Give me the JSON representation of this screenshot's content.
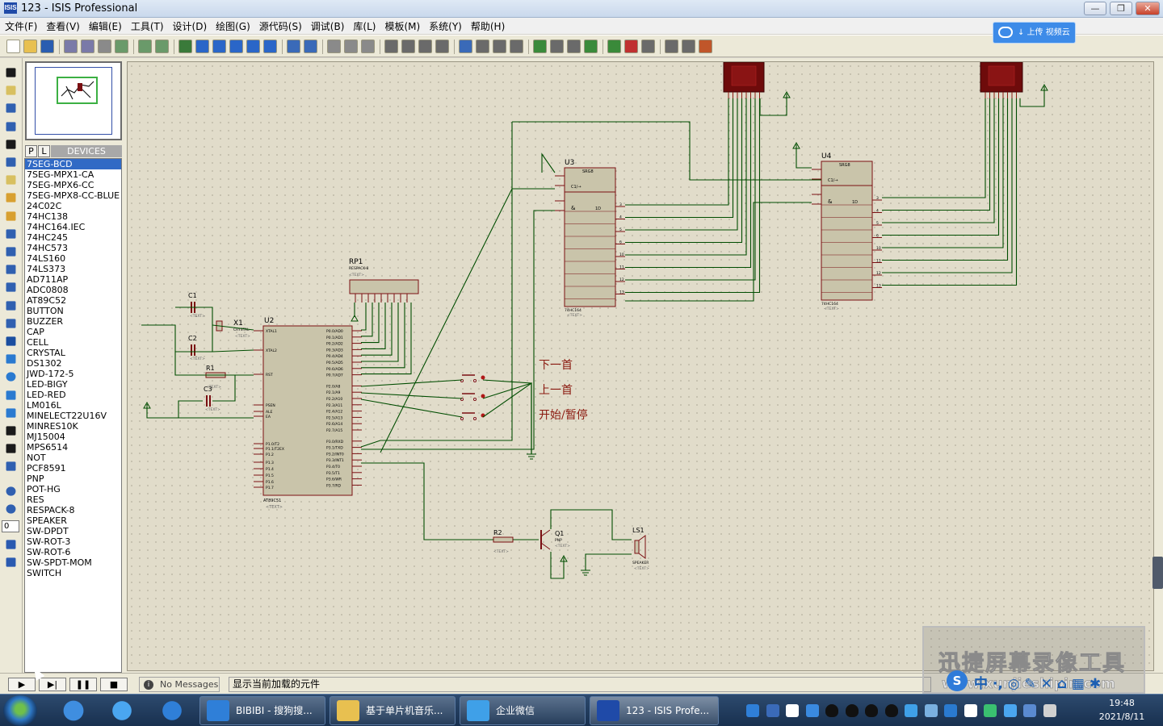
{
  "window": {
    "title": "123 - ISIS Professional",
    "icon_text": "ISIS"
  },
  "menu": [
    "文件(F)",
    "查看(V)",
    "编辑(E)",
    "工具(T)",
    "设计(D)",
    "绘图(G)",
    "源代码(S)",
    "调试(B)",
    "库(L)",
    "模板(M)",
    "系统(Y)",
    "帮助(H)"
  ],
  "cloud_badge": {
    "label": "↓ 上传 视频云"
  },
  "panel": {
    "tab_p": "P",
    "tab_l": "L",
    "devices_label": "DEVICES"
  },
  "devices": [
    "7SEG-BCD",
    "7SEG-MPX1-CA",
    "7SEG-MPX6-CC",
    "7SEG-MPX8-CC-BLUE",
    "24C02C",
    "74HC138",
    "74HC164.IEC",
    "74HC245",
    "74HC573",
    "74LS160",
    "74LS373",
    "AD711AP",
    "ADC0808",
    "AT89C52",
    "BUTTON",
    "BUZZER",
    "CAP",
    "CELL",
    "CRYSTAL",
    "DS1302",
    "JWD-172-5",
    "LED-BIGY",
    "LED-RED",
    "LM016L",
    "MINELECT22U16V",
    "MINRES10K",
    "MJ15004",
    "MPS6514",
    "NOT",
    "PCF8591",
    "PNP",
    "POT-HG",
    "RES",
    "RESPACK-8",
    "SPEAKER",
    "SW-DPDT",
    "SW-ROT-3",
    "SW-ROT-6",
    "SW-SPDT-MOM",
    "SWITCH"
  ],
  "selected_device": "7SEG-BCD",
  "rotation_value": "0",
  "schematic": {
    "labels": {
      "u2": "U2",
      "u3": "U3",
      "u4": "U4",
      "rp1": "RP1",
      "rp1_type": "RESPACK-8",
      "c1": "C1",
      "c2": "C2",
      "c3": "C3",
      "x1": "X1",
      "x1_type": "CRYSTAL",
      "r1": "R1",
      "r2": "R2",
      "q1": "Q1",
      "ls1": "LS1",
      "ls1_type": "SPEAKER",
      "u2_type": "AT89C51",
      "u3_type": "74HC164",
      "u4_type": "74HC164",
      "q1_type": "PNP",
      "text_placeholder": "<TEXT>",
      "srg": "SRG8",
      "c1_label": "C1/→",
      "amp": "&",
      "one_d": "1D"
    },
    "button_labels": [
      "下一首",
      "上一首",
      "开始/暂停"
    ],
    "u2_left_pins": [
      "XTAL1",
      "XTAL2",
      "RST",
      "PSEN",
      "ALE",
      "EA",
      "P1.0/T2",
      "P1.1/T2EX",
      "P1.2",
      "P1.3",
      "P1.4",
      "P1.5",
      "P1.6",
      "P1.7"
    ],
    "u2_right_pins": [
      "P0.0/AD0",
      "P0.1/AD1",
      "P0.2/AD2",
      "P0.3/AD3",
      "P0.4/AD4",
      "P0.5/AD5",
      "P0.6/AD6",
      "P0.7/AD7",
      "P2.0/A8",
      "P2.1/A9",
      "P2.2/A10",
      "P2.3/A11",
      "P2.4/A12",
      "P2.5/A13",
      "P2.6/A14",
      "P2.7/A15",
      "P3.0/RXD",
      "P3.1/TXD",
      "P3.2/INT0",
      "P3.3/INT1",
      "P3.4/T0",
      "P3.5/T1",
      "P3.6/WR",
      "P3.7/RD"
    ],
    "srg_out_pins": [
      "3",
      "4",
      "5",
      "6",
      "10",
      "11",
      "12",
      "13"
    ]
  },
  "status": {
    "messages": "No Messages",
    "hint": "显示当前加载的元件",
    "info_glyph": "i"
  },
  "sim_controls": [
    "▶",
    "▶|",
    "❚❚",
    "■"
  ],
  "taskbar": {
    "tasks": [
      "BIBIBI - 搜狗搜...",
      "基于单片机音乐...",
      "企业微信",
      "123 - ISIS Profe..."
    ],
    "time": "19:48",
    "date": "2021/8/11"
  },
  "watermark": {
    "main": "迅捷屏幕录像工具",
    "sub": "www.xunjieshipin.com"
  },
  "ime": {
    "logo": "S",
    "chars": "中 ·, ◎ ✎ ✕ ⌂ ▦ ✱"
  },
  "colors": {
    "component_fill": "#c9c4aa",
    "component_stroke": "#7a0f12",
    "wire": "#004d00",
    "text_red": "#8b1a10",
    "display_red": "#6e0b0b"
  }
}
